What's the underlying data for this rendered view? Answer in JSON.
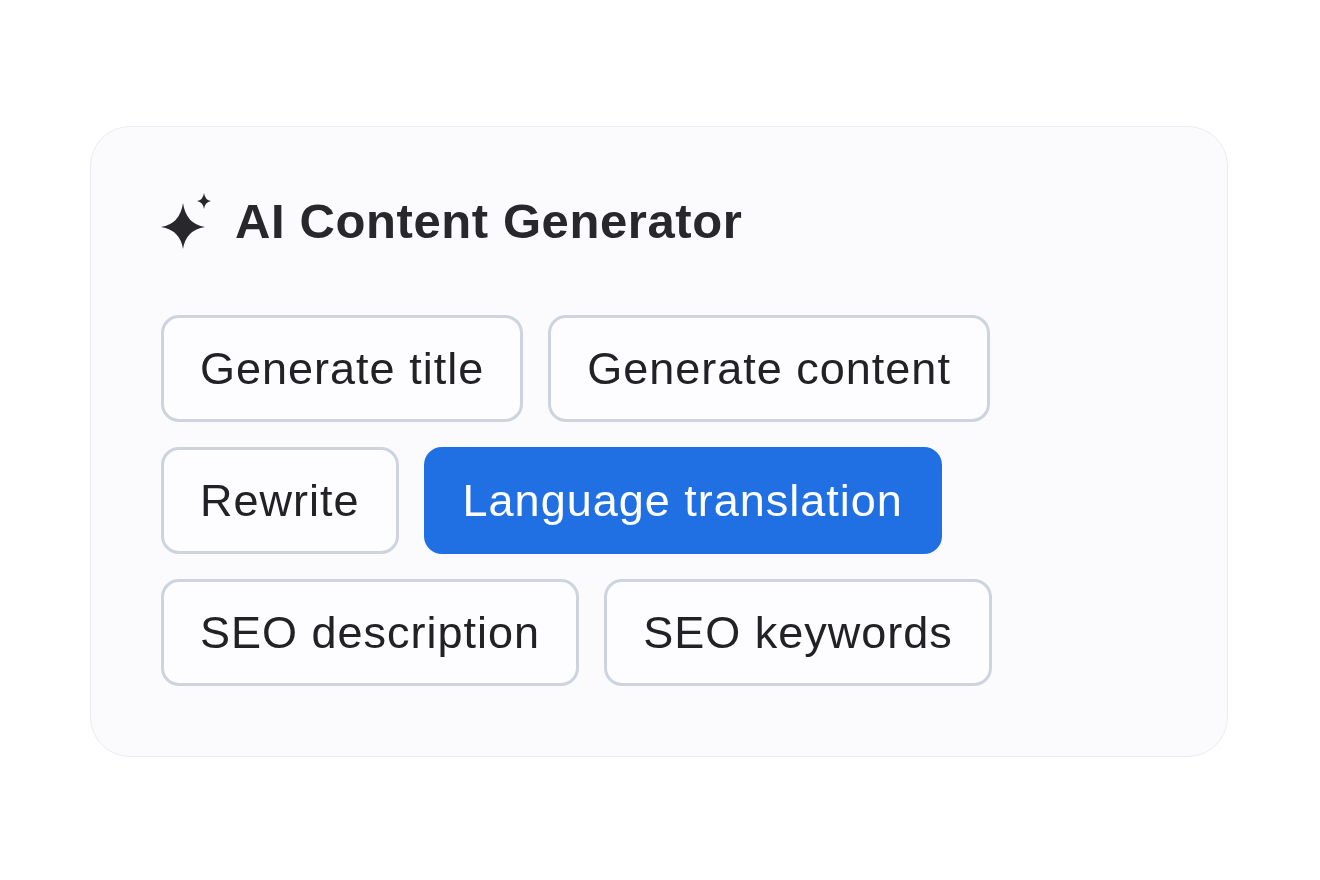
{
  "card": {
    "title": "AI Content Generator",
    "chips": [
      {
        "label": "Generate title",
        "selected": false
      },
      {
        "label": "Generate content",
        "selected": false
      },
      {
        "label": "Rewrite",
        "selected": false
      },
      {
        "label": "Language translation",
        "selected": true
      },
      {
        "label": "SEO description",
        "selected": false
      },
      {
        "label": "SEO keywords",
        "selected": false
      }
    ]
  }
}
